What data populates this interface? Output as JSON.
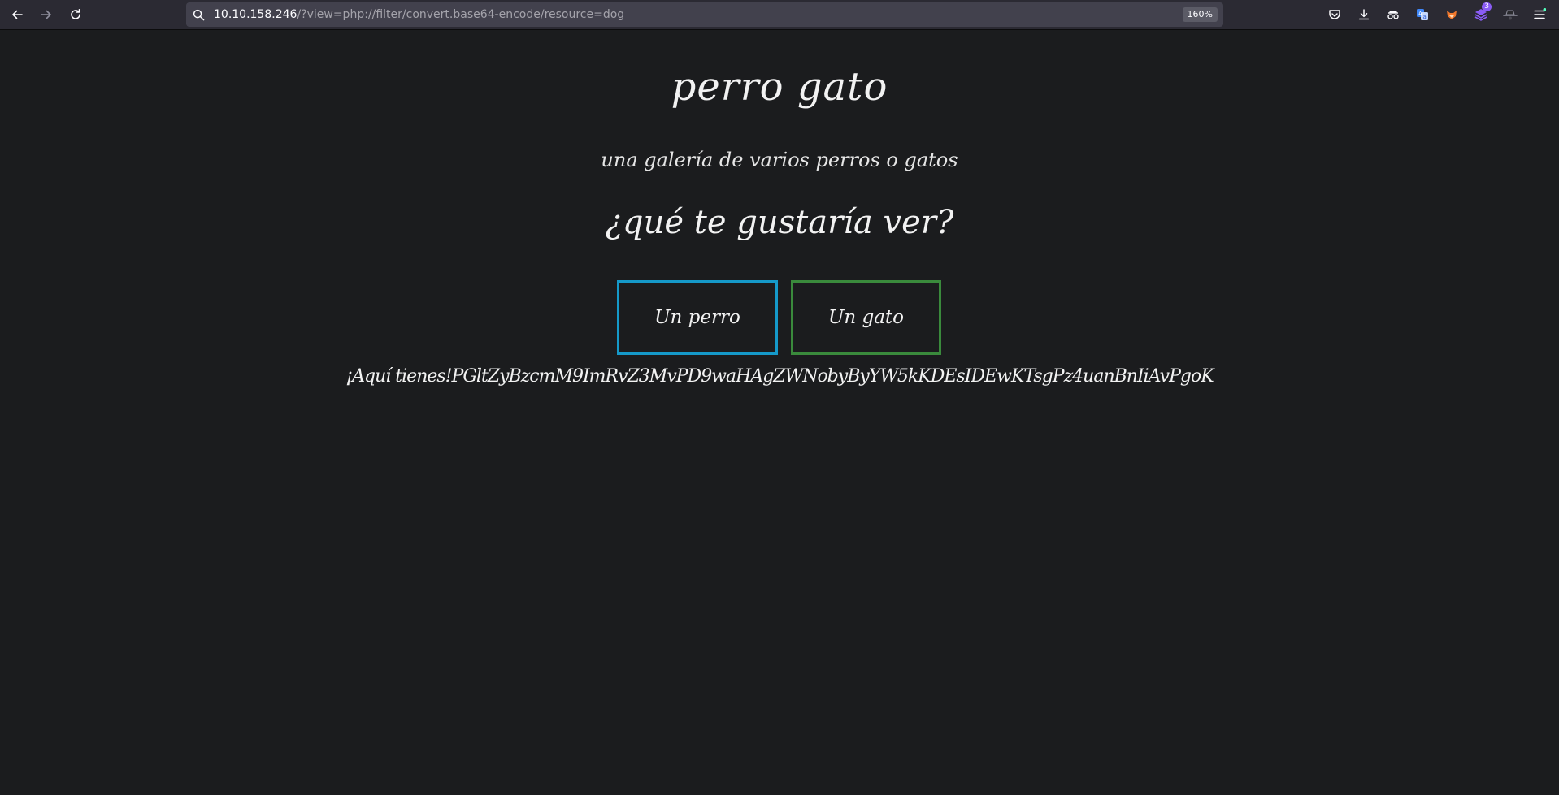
{
  "browser": {
    "url_host": "10.10.158.246",
    "url_path": "/?view=php://filter/convert.base64-encode/resource=dog",
    "zoom": "160%",
    "extension_badge_count": "3",
    "icons": [
      "back-arrow-icon",
      "forward-arrow-icon",
      "reload-icon",
      "search-icon",
      "pocket-icon",
      "download-icon",
      "spy-glasses-icon",
      "translate-icon",
      "fox-extension-icon",
      "stack-extension-icon",
      "hacker-hat-icon",
      "hamburger-menu-icon"
    ]
  },
  "page": {
    "title": "perro gato",
    "subtitle": "una galería de varios perros o gatos",
    "question": "¿qué te gustaría ver?",
    "button_dog": "Un perro",
    "button_cat": "Un gato",
    "result_prefix": "¡Aquí tienes!",
    "result_value": "PGltZyBzcmM9ImRvZ3MvPD9waHAgZWNobyByYW5kKDEsIDEwKTsgPz4uanBnIiAvPgoK"
  },
  "colors": {
    "background": "#1b1c1e",
    "dog_button_border": "#1599c9",
    "cat_button_border": "#3a8a3c",
    "toolbar": "#2b2a33",
    "urlbar": "#42414d"
  }
}
